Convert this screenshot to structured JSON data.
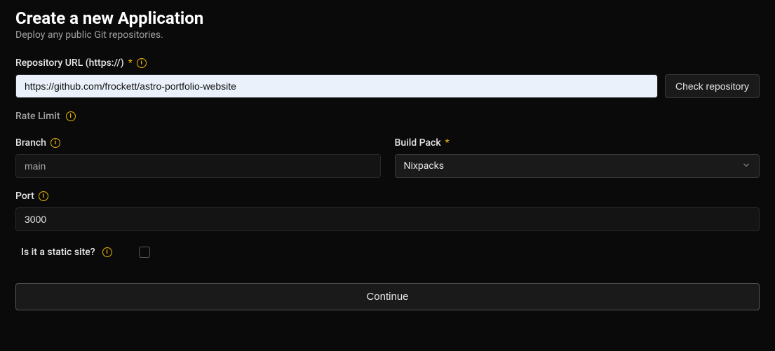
{
  "header": {
    "title": "Create a new Application",
    "subtitle": "Deploy any public Git repositories."
  },
  "repo": {
    "label": "Repository URL (https://)",
    "value": "https://github.com/frockett/astro-portfolio-website",
    "check_button": "Check repository"
  },
  "rate_limit": {
    "label": "Rate Limit"
  },
  "branch": {
    "label": "Branch",
    "value": "main"
  },
  "build_pack": {
    "label": "Build Pack",
    "selected": "Nixpacks"
  },
  "port": {
    "label": "Port",
    "value": "3000"
  },
  "static_site": {
    "label": "Is it a static site?"
  },
  "continue_button": "Continue"
}
